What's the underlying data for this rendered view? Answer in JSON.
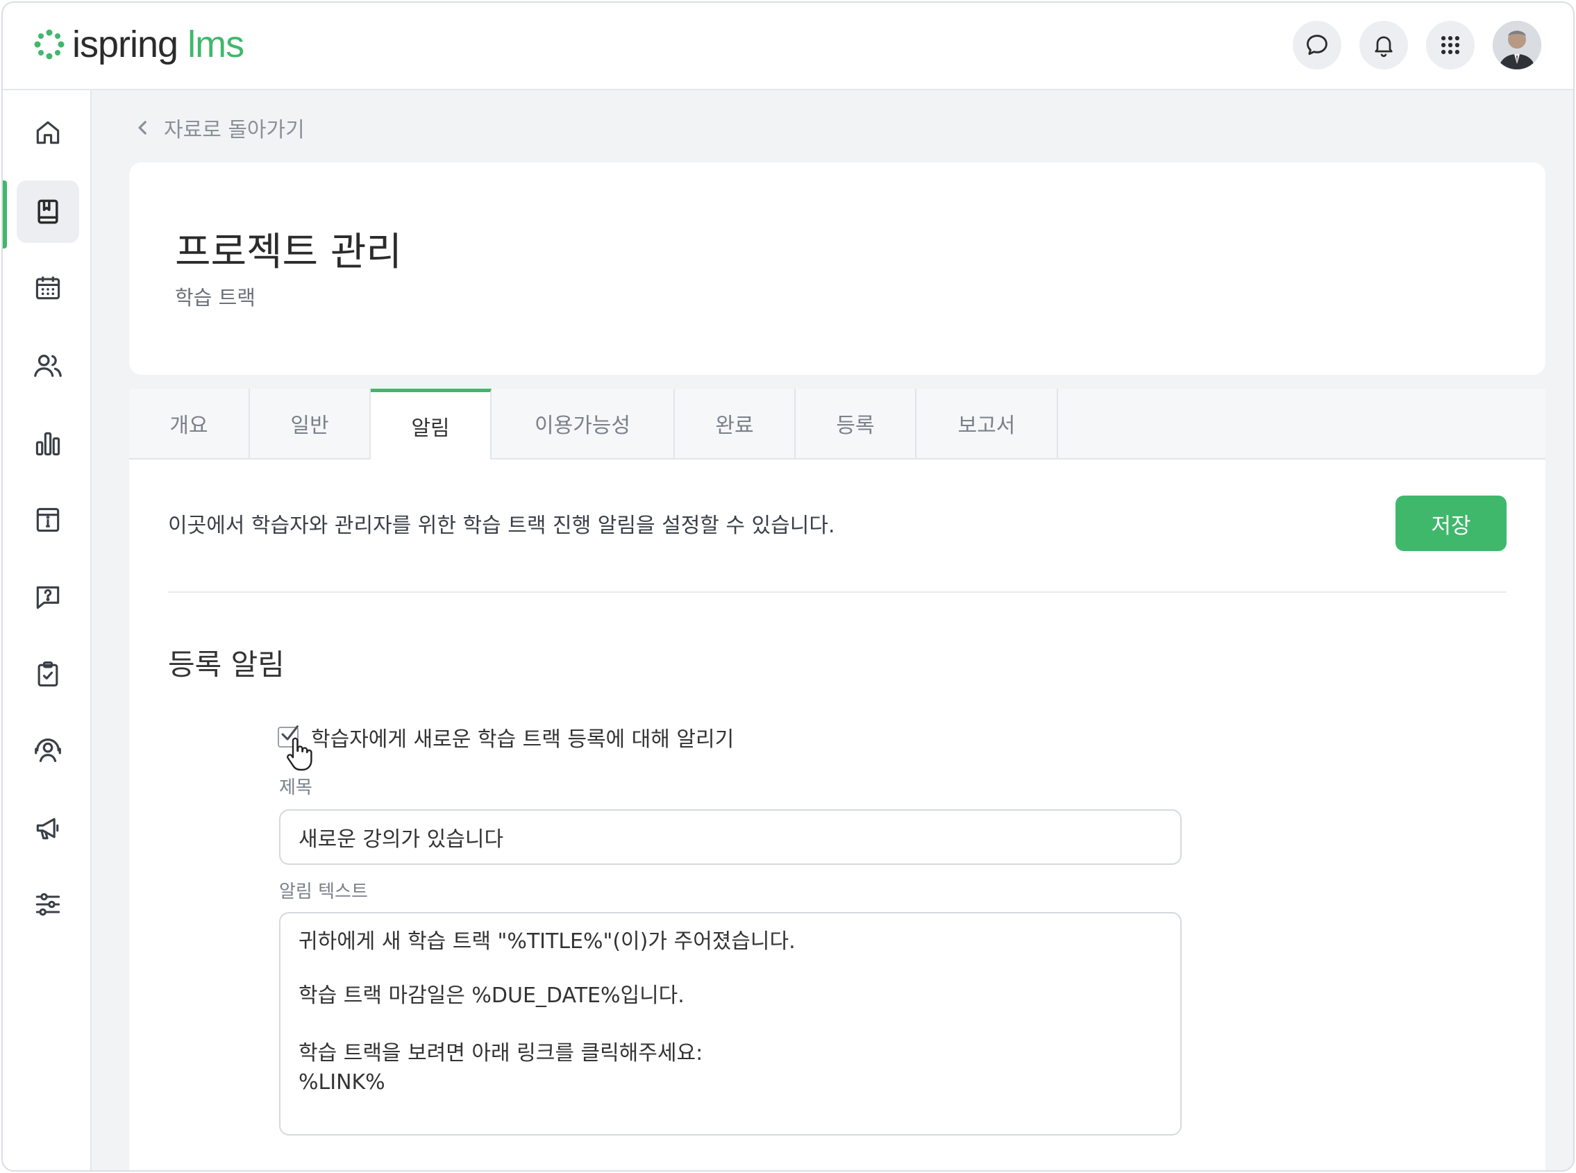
{
  "brand": {
    "name": "ispring",
    "suffix": "lms",
    "accent": "#3fb86b"
  },
  "topbar": {
    "icons": [
      "chat-icon",
      "bell-icon",
      "apps-grid-icon",
      "user-avatar"
    ]
  },
  "sidebar": {
    "items": [
      {
        "icon": "home-icon"
      },
      {
        "icon": "book-icon",
        "active": true
      },
      {
        "icon": "calendar-icon"
      },
      {
        "icon": "users-icon"
      },
      {
        "icon": "bar-chart-icon"
      },
      {
        "icon": "info-box-icon"
      },
      {
        "icon": "help-chat-icon"
      },
      {
        "icon": "clipboard-check-icon"
      },
      {
        "icon": "support-person-icon"
      },
      {
        "icon": "megaphone-icon"
      },
      {
        "icon": "sliders-icon"
      }
    ]
  },
  "back_link": "자료로 돌아가기",
  "header": {
    "title": "프로젝트 관리",
    "subtitle": "학습 트랙"
  },
  "tabs": [
    {
      "label": "개요"
    },
    {
      "label": "일반"
    },
    {
      "label": "알림",
      "active": true
    },
    {
      "label": "이용가능성"
    },
    {
      "label": "완료"
    },
    {
      "label": "등록"
    },
    {
      "label": "보고서"
    }
  ],
  "notifications": {
    "intro": "이곳에서 학습자와 관리자를 위한 학습 트랙 진행 알림을 설정할 수 있습니다.",
    "save_label": "저장",
    "section_title": "등록 알림",
    "checkbox_label": "학습자에게 새로운 학습 트랙 등록에 대해 알리기",
    "checkbox_checked": true,
    "subject_label": "제목",
    "subject_value": "새로운 강의가 있습니다",
    "body_label": "알림 텍스트",
    "body_lines": [
      "귀하에게 새 학습 트랙 \"%TITLE%\"(이)가 주어졌습니다.",
      "",
      "학습 트랙 마감일은 %DUE_DATE%입니다.",
      "",
      "",
      "학습 트랙을 보려면 아래 링크를 클릭해주세요:",
      "%LINK%"
    ]
  }
}
